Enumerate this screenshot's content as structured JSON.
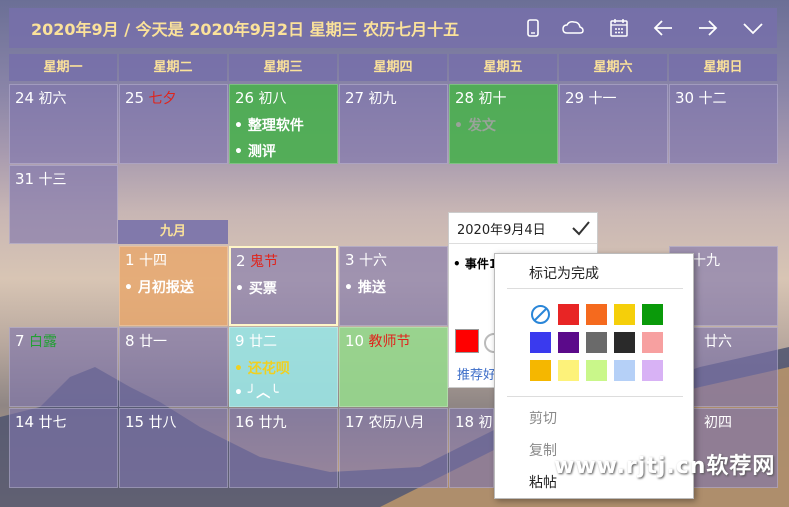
{
  "header": {
    "title": "2020年9月 / 今天是 2020年9月2日 星期三 农历七月十五",
    "icons": [
      "phone-icon",
      "cloud-icon",
      "calendar-icon",
      "arrow-left-icon",
      "arrow-right-icon",
      "chevron-down-icon"
    ]
  },
  "weekdays": [
    "星期一",
    "星期二",
    "星期三",
    "星期四",
    "星期五",
    "星期六",
    "星期日"
  ],
  "month_label": "九月",
  "days": {
    "d24": {
      "num": "24",
      "lunar": "初六"
    },
    "d25": {
      "num": "25",
      "lunar": "七夕"
    },
    "d26": {
      "num": "26",
      "lunar": "初八",
      "events": [
        "整理软件",
        "测评"
      ]
    },
    "d27": {
      "num": "27",
      "lunar": "初九"
    },
    "d28": {
      "num": "28",
      "lunar": "初十",
      "events": [
        "发文"
      ]
    },
    "d29": {
      "num": "29",
      "lunar": "十一"
    },
    "d30": {
      "num": "30",
      "lunar": "十二"
    },
    "d31": {
      "num": "31",
      "lunar": "十三"
    },
    "s1": {
      "num": "1",
      "lunar": "十四",
      "events": [
        "月初报送"
      ]
    },
    "s2": {
      "num": "2",
      "lunar": "鬼节",
      "events": [
        "买票"
      ]
    },
    "s3": {
      "num": "3",
      "lunar": "十六",
      "events": [
        "推送"
      ]
    },
    "s6": {
      "lunar": "十九"
    },
    "s7": {
      "num": "7",
      "lunar": "白露"
    },
    "s8": {
      "num": "8",
      "lunar": "廿一"
    },
    "s9": {
      "num": "9",
      "lunar": "廿二",
      "events": [
        "还花呗",
        "╯︿╰"
      ]
    },
    "s10": {
      "num": "10",
      "lunar": "教师节"
    },
    "s13": {
      "lunar": "廿六"
    },
    "s14": {
      "num": "14",
      "lunar": "廿七"
    },
    "s15": {
      "num": "15",
      "lunar": "廿八"
    },
    "s16": {
      "num": "16",
      "lunar": "廿九"
    },
    "s17": {
      "num": "17",
      "lunar": "农历八月"
    },
    "s18": {
      "num": "18",
      "lunar": "初"
    },
    "s20": {
      "lunar": "初四"
    }
  },
  "popup": {
    "date": "2020年9月4日",
    "event": "事件1",
    "link": "推荐好"
  },
  "context_menu": {
    "mark_done": "标记为完成",
    "colors": [
      "#ffffff",
      "#e82525",
      "#f56a1e",
      "#f5cf0a",
      "#0a9a0a",
      "#3a3aee",
      "#5b0a8a",
      "#6a6a6a",
      "#2a2a2a",
      "#f7a0a0",
      "#f5b700",
      "#fdf27a",
      "#c9f78a",
      "#b5d0f7",
      "#d8b2f5"
    ],
    "cut": "剪切",
    "copy": "复制",
    "paste": "粘帖"
  },
  "watermark": "www.rjtj.cn软荐网"
}
